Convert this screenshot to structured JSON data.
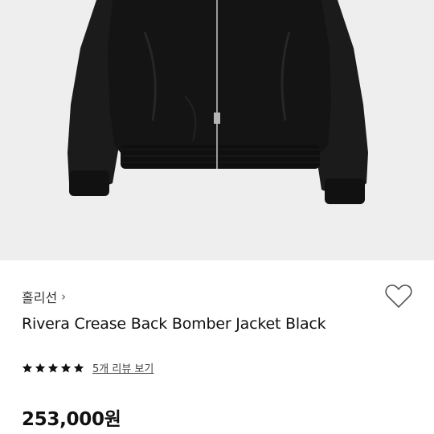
{
  "product_image": {
    "alt_icon": "jacket-photo"
  },
  "seller": {
    "name": "홀리선",
    "chevron": "›"
  },
  "wishlist": {
    "icon": "heart-outline-icon"
  },
  "product": {
    "title": "Rivera Crease Back Bomber Jacket Black",
    "rating_stars": 5,
    "review_link": "5개 리뷰 보기",
    "price": "253,000원"
  },
  "colors": {
    "star": "#111111",
    "background": "#ffffff",
    "image_bg": "#eeeeee"
  }
}
